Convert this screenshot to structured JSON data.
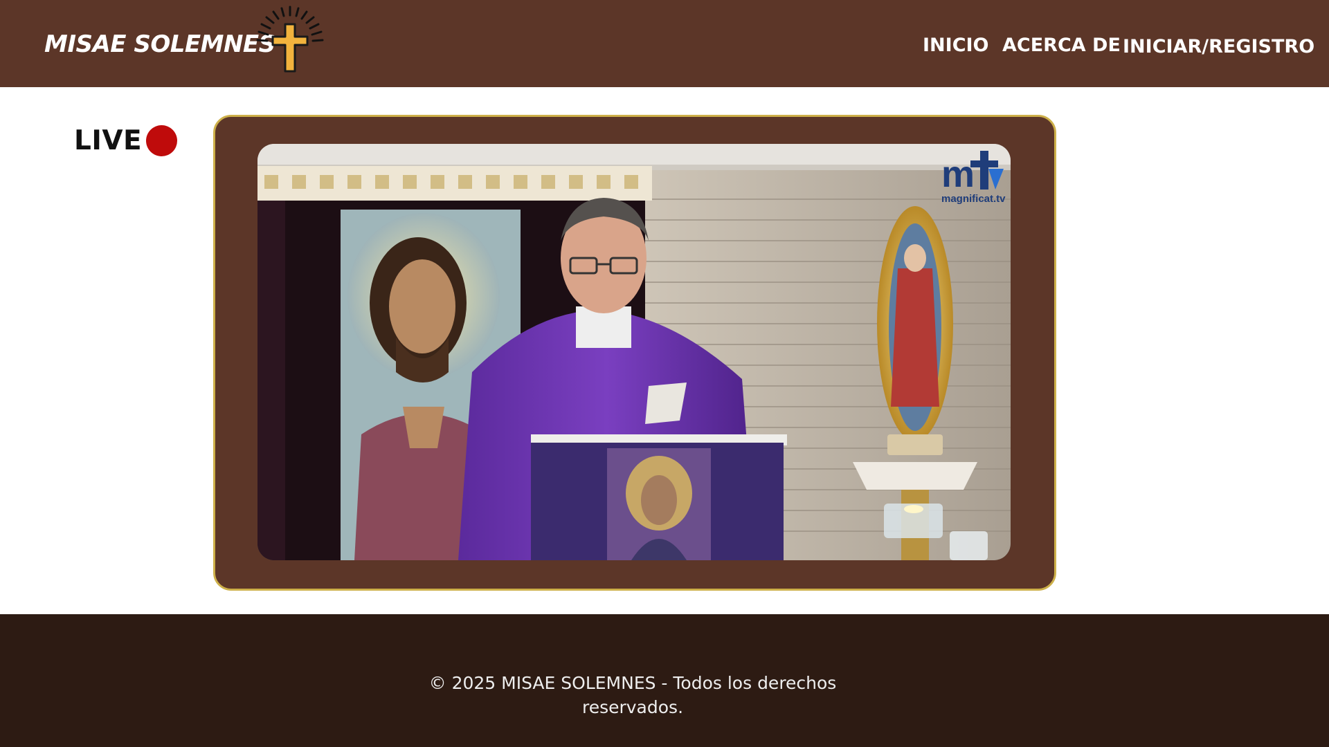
{
  "header": {
    "brand": "MISAE SOLEMNES",
    "logo_icon": "cross-with-rays-icon",
    "nav": [
      {
        "label": "INICIO"
      },
      {
        "label": "ACERCA DE"
      },
      {
        "label": "INICIAR/REGISTRO"
      }
    ]
  },
  "live": {
    "label": "LIVE",
    "indicator_color": "#bf0b0b"
  },
  "player": {
    "channel_logo_text": "magnificat.tv",
    "channel_logo_mark": "mT"
  },
  "footer": {
    "copyright": "© 2025 MISAE SOLEMNES - Todos los derechos reservados."
  },
  "colors": {
    "header_bg": "#5c3628",
    "footer_bg": "#2d1b13",
    "frame_border": "#cdb04a"
  }
}
